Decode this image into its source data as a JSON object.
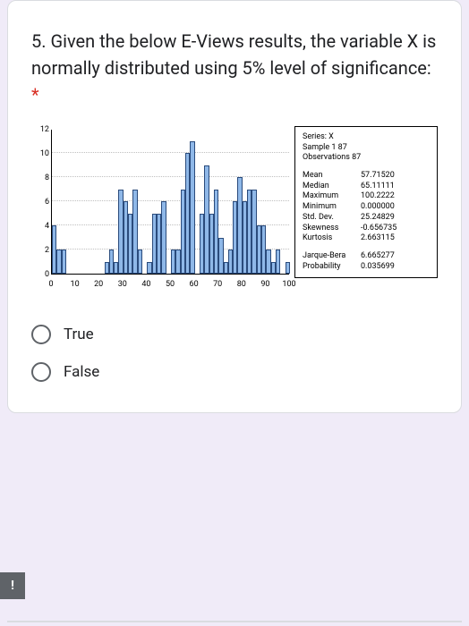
{
  "question": {
    "text": "5. Given the below E-Views results, the variable X is normally distributed using 5% level of significance:",
    "required_marker": "*"
  },
  "chart_data": {
    "type": "bar",
    "x": [
      2,
      4,
      6,
      8,
      10,
      12,
      14,
      16,
      18,
      20,
      22,
      24,
      26,
      28,
      30,
      32,
      34,
      36,
      38,
      40,
      42,
      44,
      46,
      48,
      50,
      52,
      54,
      56,
      58,
      60,
      62,
      64,
      66,
      68,
      70,
      72,
      74,
      76,
      78,
      80,
      82,
      84,
      86,
      88,
      90,
      92,
      94,
      96,
      98,
      100
    ],
    "values": [
      4,
      2,
      2,
      0,
      0,
      0,
      0,
      0,
      0,
      0,
      0,
      1,
      2,
      1,
      7,
      6,
      5,
      7,
      2,
      0,
      1,
      5,
      5,
      6,
      0,
      2,
      2,
      7,
      10,
      11,
      0,
      5,
      9,
      5,
      7,
      3,
      1,
      2,
      6,
      8,
      6,
      7,
      7,
      4,
      4,
      2,
      1,
      2,
      0,
      1
    ],
    "xticks": [
      0,
      10,
      20,
      30,
      40,
      50,
      60,
      70,
      80,
      90,
      100
    ],
    "yticks": [
      0,
      2,
      4,
      6,
      8,
      10,
      12
    ],
    "ylim": [
      0,
      12
    ]
  },
  "stats": {
    "header": [
      "Series: X",
      "Sample 1 87",
      "Observations 87"
    ],
    "rows": [
      {
        "label": "Mean",
        "value": "57.71520"
      },
      {
        "label": "Median",
        "value": "65.11111"
      },
      {
        "label": "Maximum",
        "value": "100.2222"
      },
      {
        "label": "Minimum",
        "value": "0.000000"
      },
      {
        "label": "Std. Dev.",
        "value": "25.24829"
      },
      {
        "label": "Skewness",
        "value": "-0.656735"
      },
      {
        "label": "Kurtosis",
        "value": "2.663115"
      }
    ],
    "footer": [
      {
        "label": "Jarque-Bera",
        "value": "6.665277"
      },
      {
        "label": "Probability",
        "value": "0.035699"
      }
    ]
  },
  "options": {
    "true_label": "True",
    "false_label": "False"
  },
  "badge": "!"
}
